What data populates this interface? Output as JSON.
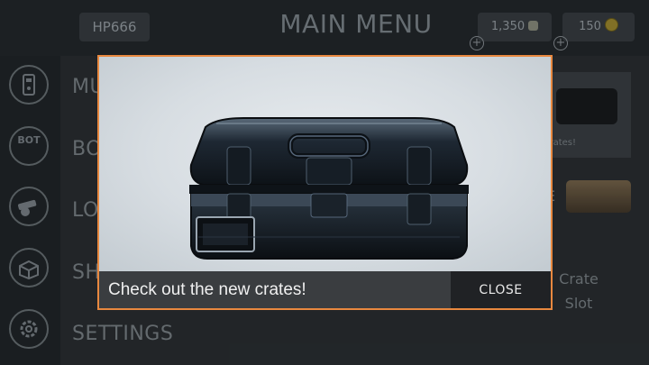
{
  "header": {
    "player_name": "HP666",
    "title": "MAIN MENU",
    "credits": "1,350",
    "gold": "150",
    "plus_symbol": "+"
  },
  "side_menu": {
    "labels": [
      "MU",
      "BO",
      "LO",
      "SH",
      "SETTINGS"
    ],
    "icons": [
      "remote-control-icon",
      "bot-icon",
      "cannon-icon",
      "shop-box-icon",
      "gear-icon"
    ],
    "bot_icon_text": "BOT"
  },
  "right_panel": {
    "card_caption": "crates!",
    "slot_letter": "E",
    "crate_slot_line1": "Crate",
    "crate_slot_line2": "Slot"
  },
  "modal": {
    "message": "Check out the new crates!",
    "close_label": "CLOSE",
    "accent_color": "#e8883f"
  }
}
